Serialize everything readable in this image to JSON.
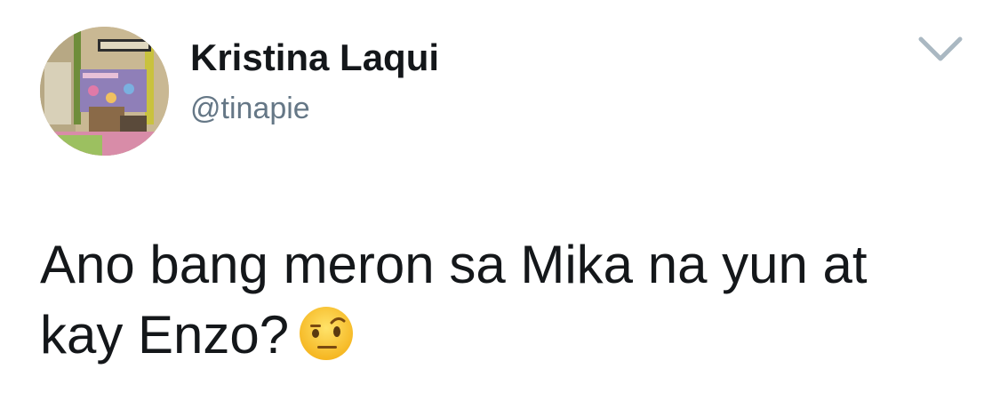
{
  "author": {
    "display_name": "Kristina Laqui",
    "handle": "@tinapie",
    "avatar_icon": "classroom-photo-avatar"
  },
  "menu": {
    "icon": "chevron-down-icon"
  },
  "tweet": {
    "line1": "Ano bang meron sa Mika na yun at",
    "line2": "kay Enzo?",
    "emoji": "face-with-raised-eyebrow-emoji"
  },
  "colors": {
    "text": "#14171a",
    "secondary": "#657786",
    "caret": "#aab8c2"
  }
}
